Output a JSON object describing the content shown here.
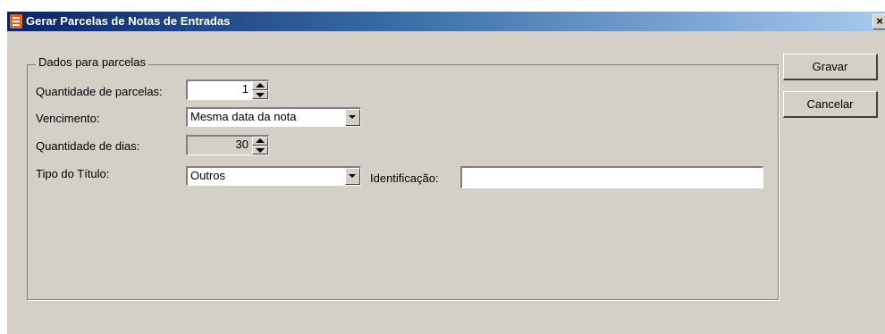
{
  "window": {
    "title": "Gerar Parcelas de Notas de Entradas",
    "close_glyph": "×"
  },
  "group": {
    "legend": "Dados para parcelas"
  },
  "form": {
    "quantidade_parcelas": {
      "label": "Quantidade de parcelas:",
      "value": "1"
    },
    "vencimento": {
      "label": "Vencimento:",
      "selected": "Mesma data da nota"
    },
    "quantidade_dias": {
      "label": "Quantidade de dias:",
      "value": "30"
    },
    "tipo_titulo": {
      "label": "Tipo do Título:",
      "selected": "Outros"
    },
    "identificacao": {
      "label": "Identificação:",
      "value": ""
    }
  },
  "buttons": {
    "gravar": "Gravar",
    "cancelar": "Cancelar"
  },
  "icons": {
    "app": "document-icon",
    "spin_up": "spin-up-icon",
    "spin_down": "spin-down-icon",
    "dropdown": "dropdown-arrow-icon"
  },
  "colors": {
    "title_bar_start": "#0a246a",
    "title_bar_end": "#a6caf0",
    "window_face": "#d4d0c8",
    "app_icon": "#e8641a"
  }
}
